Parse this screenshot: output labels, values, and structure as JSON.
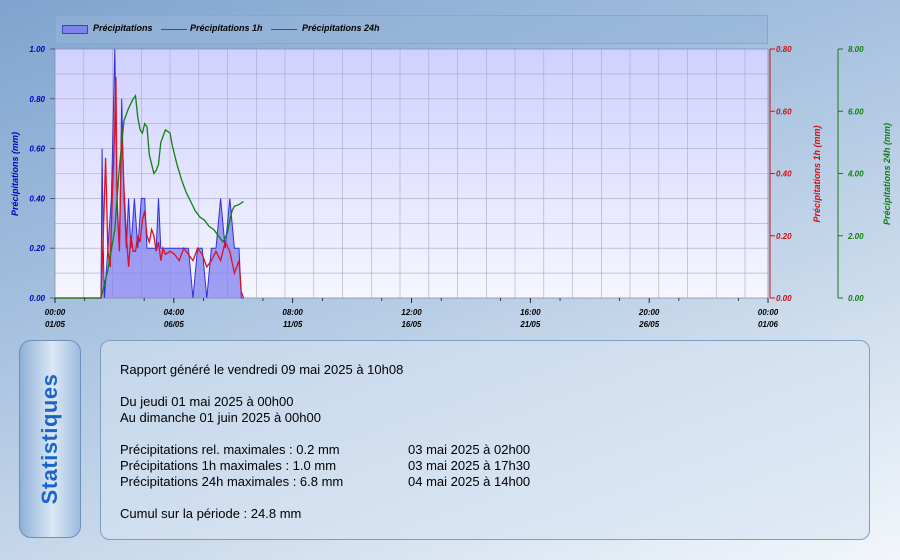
{
  "legend": {
    "precip": "Précipitations",
    "precip1h": "Précipitations 1h",
    "precip24h": "Précipitations 24h"
  },
  "colors": {
    "precip_fill": "#8080f0",
    "precip_line": "#3030d8",
    "precip1h": "#e01020",
    "precip24h": "#108010",
    "plot_bg_top": "#d0d0ff",
    "plot_bg_bottom": "#f6f6ff",
    "axis_left": "#0000c0",
    "axis_right1": "#d01010",
    "axis_right2": "#108010",
    "stats_title": "#1a66c8"
  },
  "chart_data": {
    "type": "line",
    "title": "",
    "x_ticks": [
      {
        "time": "00:00",
        "date": "01/05"
      },
      {
        "time": "04:00",
        "date": "06/05"
      },
      {
        "time": "08:00",
        "date": "11/05"
      },
      {
        "time": "12:00",
        "date": "16/05"
      },
      {
        "time": "16:00",
        "date": "21/05"
      },
      {
        "time": "20:00",
        "date": "26/05"
      },
      {
        "time": "00:00",
        "date": "01/06"
      }
    ],
    "xlim_days": [
      0,
      31
    ],
    "grid": true,
    "legend_placement": "top",
    "axes": [
      {
        "id": "left",
        "label": "Précipitations (mm)",
        "ylim": [
          0,
          1.0
        ],
        "ticks": [
          "0.00",
          "0.20",
          "0.40",
          "0.60",
          "0.80",
          "1.00"
        ]
      },
      {
        "id": "right1",
        "label": "Précipitations 1h (mm)",
        "ylim": [
          0,
          0.8
        ],
        "ticks": [
          "0.00",
          "0.20",
          "0.40",
          "0.60",
          "0.80"
        ]
      },
      {
        "id": "right2",
        "label": "Précipitations 24h (mm)",
        "ylim": [
          0,
          8.0
        ],
        "ticks": [
          "0.00",
          "2.00",
          "4.00",
          "6.00",
          "8.00"
        ]
      }
    ],
    "series": [
      {
        "name": "Précipitations",
        "axis": "left",
        "style": "area",
        "points": [
          [
            0,
            0
          ],
          [
            2.0,
            0
          ],
          [
            2.05,
            0.6
          ],
          [
            2.1,
            0.2
          ],
          [
            2.15,
            0.0
          ],
          [
            2.3,
            0.2
          ],
          [
            2.45,
            0.4
          ],
          [
            2.6,
            1.0
          ],
          [
            2.7,
            0.4
          ],
          [
            2.8,
            0.2
          ],
          [
            2.9,
            0.8
          ],
          [
            3.0,
            0.4
          ],
          [
            3.1,
            0.2
          ],
          [
            3.2,
            0.4
          ],
          [
            3.3,
            0.2
          ],
          [
            3.45,
            0.4
          ],
          [
            3.6,
            0.2
          ],
          [
            3.75,
            0.4
          ],
          [
            3.9,
            0.4
          ],
          [
            4.0,
            0.2
          ],
          [
            4.2,
            0.2
          ],
          [
            4.4,
            0.2
          ],
          [
            4.5,
            0.4
          ],
          [
            4.6,
            0.2
          ],
          [
            4.8,
            0.2
          ],
          [
            5.0,
            0.2
          ],
          [
            5.2,
            0.2
          ],
          [
            5.4,
            0.2
          ],
          [
            5.6,
            0.2
          ],
          [
            5.8,
            0.2
          ],
          [
            6.0,
            0.0
          ],
          [
            6.2,
            0.2
          ],
          [
            6.4,
            0.2
          ],
          [
            6.6,
            0.0
          ],
          [
            6.8,
            0.2
          ],
          [
            7.0,
            0.2
          ],
          [
            7.2,
            0.4
          ],
          [
            7.4,
            0.2
          ],
          [
            7.6,
            0.4
          ],
          [
            7.8,
            0.2
          ],
          [
            8.0,
            0.2
          ],
          [
            8.1,
            0.0
          ],
          [
            8.2,
            0.0
          ]
        ]
      },
      {
        "name": "Précipitations 1h",
        "axis": "right1",
        "style": "line",
        "points": [
          [
            0,
            0
          ],
          [
            2.0,
            0
          ],
          [
            2.1,
            0.2
          ],
          [
            2.2,
            0.45
          ],
          [
            2.3,
            0.15
          ],
          [
            2.4,
            0.1
          ],
          [
            2.5,
            0.35
          ],
          [
            2.6,
            0.55
          ],
          [
            2.65,
            0.71
          ],
          [
            2.7,
            0.3
          ],
          [
            2.8,
            0.15
          ],
          [
            2.9,
            0.55
          ],
          [
            3.0,
            0.35
          ],
          [
            3.1,
            0.2
          ],
          [
            3.2,
            0.1
          ],
          [
            3.3,
            0.2
          ],
          [
            3.4,
            0.15
          ],
          [
            3.5,
            0.15
          ],
          [
            3.6,
            0.2
          ],
          [
            3.7,
            0.18
          ],
          [
            3.8,
            0.25
          ],
          [
            3.9,
            0.28
          ],
          [
            4.0,
            0.2
          ],
          [
            4.1,
            0.18
          ],
          [
            4.2,
            0.22
          ],
          [
            4.3,
            0.2
          ],
          [
            4.4,
            0.15
          ],
          [
            4.5,
            0.18
          ],
          [
            4.6,
            0.12
          ],
          [
            4.7,
            0.16
          ],
          [
            4.8,
            0.14
          ],
          [
            5.0,
            0.15
          ],
          [
            5.2,
            0.14
          ],
          [
            5.4,
            0.12
          ],
          [
            5.6,
            0.16
          ],
          [
            5.8,
            0.14
          ],
          [
            6.0,
            0.12
          ],
          [
            6.2,
            0.16
          ],
          [
            6.4,
            0.14
          ],
          [
            6.6,
            0.1
          ],
          [
            6.8,
            0.12
          ],
          [
            7.0,
            0.15
          ],
          [
            7.2,
            0.12
          ],
          [
            7.4,
            0.18
          ],
          [
            7.6,
            0.15
          ],
          [
            7.8,
            0.08
          ],
          [
            8.0,
            0.12
          ],
          [
            8.1,
            0.02
          ],
          [
            8.2,
            0.0
          ]
        ]
      },
      {
        "name": "Précipitations 24h",
        "axis": "right2",
        "style": "line",
        "points": [
          [
            0,
            0
          ],
          [
            2.0,
            0
          ],
          [
            2.1,
            0.3
          ],
          [
            2.3,
            0.9
          ],
          [
            2.6,
            2.2
          ],
          [
            2.8,
            4.2
          ],
          [
            3.0,
            5.7
          ],
          [
            3.2,
            6.1
          ],
          [
            3.4,
            6.4
          ],
          [
            3.5,
            6.5
          ],
          [
            3.6,
            5.8
          ],
          [
            3.7,
            5.4
          ],
          [
            3.8,
            5.3
          ],
          [
            3.9,
            5.6
          ],
          [
            4.0,
            5.5
          ],
          [
            4.1,
            4.6
          ],
          [
            4.2,
            4.3
          ],
          [
            4.3,
            4.0
          ],
          [
            4.4,
            4.1
          ],
          [
            4.5,
            4.3
          ],
          [
            4.6,
            5.0
          ],
          [
            4.8,
            5.4
          ],
          [
            5.0,
            5.3
          ],
          [
            5.1,
            4.9
          ],
          [
            5.3,
            4.3
          ],
          [
            5.5,
            3.8
          ],
          [
            5.7,
            3.4
          ],
          [
            5.9,
            3.1
          ],
          [
            6.1,
            2.8
          ],
          [
            6.3,
            2.6
          ],
          [
            6.5,
            2.5
          ],
          [
            6.7,
            2.3
          ],
          [
            6.9,
            2.2
          ],
          [
            7.1,
            2.0
          ],
          [
            7.3,
            1.8
          ],
          [
            7.5,
            2.1
          ],
          [
            7.6,
            2.5
          ],
          [
            7.7,
            2.8
          ],
          [
            7.8,
            2.95
          ],
          [
            8.0,
            3.0
          ],
          [
            8.2,
            3.1
          ]
        ]
      }
    ]
  },
  "stats": {
    "title": "Statistiques",
    "generated": "Rapport généré le vendredi 09 mai 2025 à 10h08",
    "from": "Du jeudi 01 mai 2025 à 00h00",
    "to": "Au dimanche 01 juin 2025 à 00h00",
    "rows": [
      {
        "label": "Précipitations rel. maximales : 0.2 mm",
        "when": "03 mai 2025 à 02h00"
      },
      {
        "label": "Précipitations 1h maximales : 1.0 mm",
        "when": "03 mai 2025 à 17h30"
      },
      {
        "label": "Précipitations 24h maximales : 6.8 mm",
        "when": "04 mai 2025 à 14h00"
      }
    ],
    "total": "Cumul sur la période : 24.8 mm"
  }
}
